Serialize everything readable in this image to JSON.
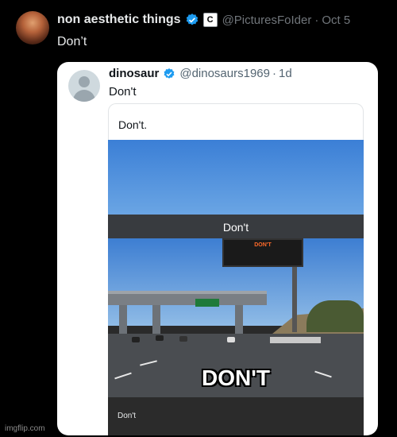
{
  "tweet": {
    "author_name": "non aesthetic things",
    "affiliation_badge": "C",
    "handle": "@PicturesFoIder",
    "separator": "·",
    "date": "Oct 5",
    "text": "Don’t"
  },
  "quoted_tweet": {
    "author_name": "dinosaur",
    "handle": "@dinosaurs1969",
    "separator": "·",
    "date": "1d",
    "text": "Don't",
    "quoted_text": "Don't.",
    "image": {
      "caption_top": "Don't",
      "billboard_text": "DON'T",
      "caption_big": "DON'T",
      "caption_bottom": "Don't"
    }
  },
  "watermark": "imgflip.com",
  "colors": {
    "background": "#000000",
    "verified_blue": "#1d9bf0",
    "card": "#ffffff"
  },
  "icons": [
    "verified-badge-icon",
    "default-avatar-icon"
  ]
}
